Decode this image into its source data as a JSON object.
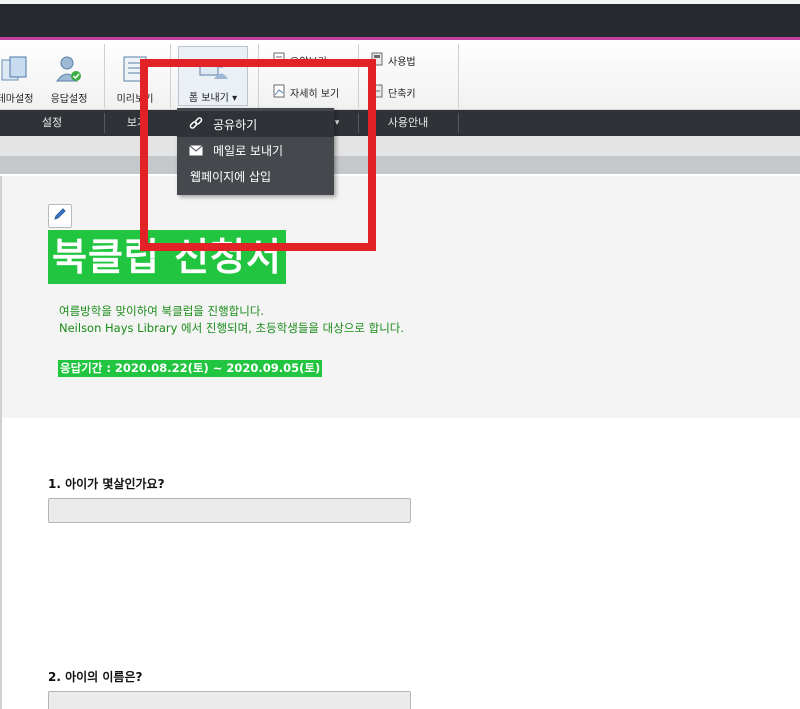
{
  "ribbon": {
    "buttons": [
      {
        "label": "테마설정",
        "icon": "theme-settings-icon"
      },
      {
        "label": "응답설정",
        "icon": "response-settings-icon"
      },
      {
        "label": "미리보기",
        "icon": "preview-icon"
      },
      {
        "label": "폼 보내기 ▾",
        "icon": "send-form-icon"
      }
    ],
    "small_items": [
      {
        "label": "요약보기",
        "icon": "summary-view-icon"
      },
      {
        "label": "자세히 보기",
        "icon": "detail-view-icon"
      },
      {
        "label": "사용법",
        "icon": "usage-icon"
      },
      {
        "label": "단축키",
        "icon": "shortcut-icon"
      }
    ],
    "groups": {
      "settings": "설정",
      "view": "보기",
      "view_arrow": "▾",
      "help": "사용안내"
    }
  },
  "dropdown": {
    "items": [
      {
        "label": "공유하기",
        "icon": "link-icon"
      },
      {
        "label": "메일로 보내기",
        "icon": "mail-icon"
      },
      {
        "label": "웹페이지에 삽입",
        "icon": ""
      }
    ]
  },
  "form": {
    "title": "북클럽 신청서",
    "description_line1": "여름방학을 맞이하여 북클럽을 진행합니다.",
    "description_line2": "Neilson Hays Library 에서 진행되며, 초등학생들을 대상으로 합니다.",
    "period": "응답기간 : 2020.08.22(토) ~ 2020.09.05(토)",
    "questions": [
      {
        "label": "1. 아이가 몇살인가요?",
        "value": ""
      },
      {
        "label": "2. 아이의 이름은?",
        "value": ""
      }
    ]
  },
  "colors": {
    "accent_bar": "#c13fa1",
    "title_bg": "#21c53f",
    "highlight": "#e32228"
  }
}
